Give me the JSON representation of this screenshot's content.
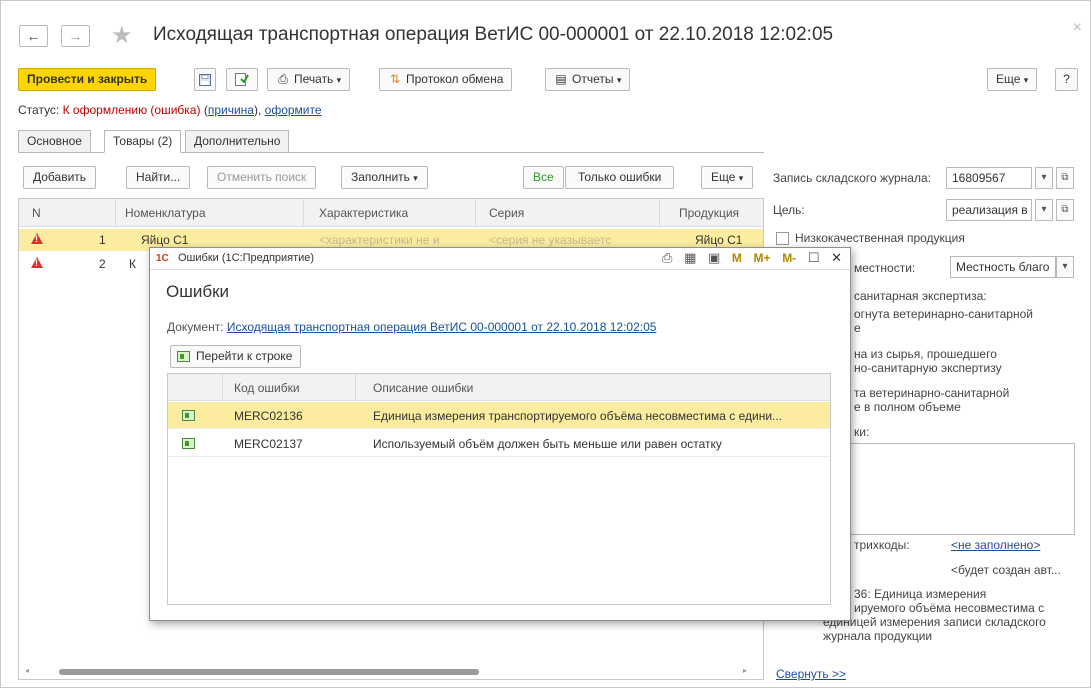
{
  "header": {
    "back": "←",
    "forward": "→",
    "star": "★",
    "title": "Исходящая транспортная операция ВетИС 00-000001 от 22.10.2018 12:02:05",
    "close": "×"
  },
  "toolbar": {
    "post_close": "Провести и закрыть",
    "save_icon": "floppy-icon",
    "post_icon": "post-icon",
    "print": "Печать",
    "exchange": "Протокол обмена",
    "reports": "Отчеты",
    "more": "Еще",
    "help": "?"
  },
  "status": {
    "prefix": "Статус: ",
    "state": "К оформлению (ошибка)",
    "reason": "причина",
    "sep": ", ",
    "action": "оформите"
  },
  "tabs": [
    {
      "label": "Основное"
    },
    {
      "label": "Товары (2)"
    },
    {
      "label": "Дополнительно"
    }
  ],
  "items_toolbar": {
    "add": "Добавить",
    "find": "Найти...",
    "cancel_search": "Отменить поиск",
    "fill": "Заполнить",
    "all": "Все",
    "errors_only": "Только ошибки",
    "more": "Еще"
  },
  "grid": {
    "columns": [
      "N",
      "Номенклатура",
      "Характеристика",
      "Серия",
      "Продукция"
    ],
    "rows": [
      {
        "n": "1",
        "item": "Яйцо С1",
        "char": "<характеристики не и",
        "series": "<серия не указываетс",
        "product": "Яйцо С1"
      },
      {
        "n": "2",
        "item": "К",
        "char": "",
        "series": "",
        "product": ""
      }
    ]
  },
  "right_panel": {
    "journal_label": "Запись складского журнала:",
    "journal_value": "16809567",
    "goal_label": "Цель:",
    "goal_value": "реализация в",
    "low_quality": "Низкокачественная продукция",
    "locality_label": "местности:",
    "locality_value": "Местность благо",
    "vet_label": "санитарная экспертиза:",
    "opt1_line1": "огнута ветеринарно-санитарной",
    "opt1_line2": "е",
    "opt2_line1": "на из сырья, прошедшего",
    "opt2_line2": "но-санитарную экспертизу",
    "opt3_line1": "та ветеринарно-санитарной",
    "opt3_line2": "е в полном объеме",
    "notes_label": "ки:",
    "barcodes_label": "трихкоды:",
    "barcodes_value": "<не заполнено>",
    "will_create": "<будет создан авт...",
    "err_line1": "36: Единица измерения",
    "err_line2": "ируемого объёма несовместима с",
    "err_line3": "единицей измерения записи складского",
    "err_line4": "журнала продукции",
    "collapse": "Свернуть >>"
  },
  "modal": {
    "logo": "1С",
    "caption": "Ошибки (1С:Предприятие)",
    "tools": {
      "m": "M",
      "mplus": "M+",
      "mminus": "M-"
    },
    "heading": "Ошибки",
    "doc_label": "Документ: ",
    "doc_link": "Исходящая транспортная операция ВетИС 00-000001 от 22.10.2018 12:02:05",
    "goto": "Перейти к строке",
    "columns": [
      "Код ошибки",
      "Описание ошибки"
    ],
    "rows": [
      {
        "code": "MERC02136",
        "desc": "Единица измерения транспортируемого объёма несовместима с едини..."
      },
      {
        "code": "MERC02137",
        "desc": "Используемый объём должен быть меньше или равен остатку"
      }
    ]
  },
  "colors": {
    "primary": "#ffd500",
    "selection": "#fbeca0",
    "link": "#1a4fa0",
    "error": "#c00000"
  }
}
